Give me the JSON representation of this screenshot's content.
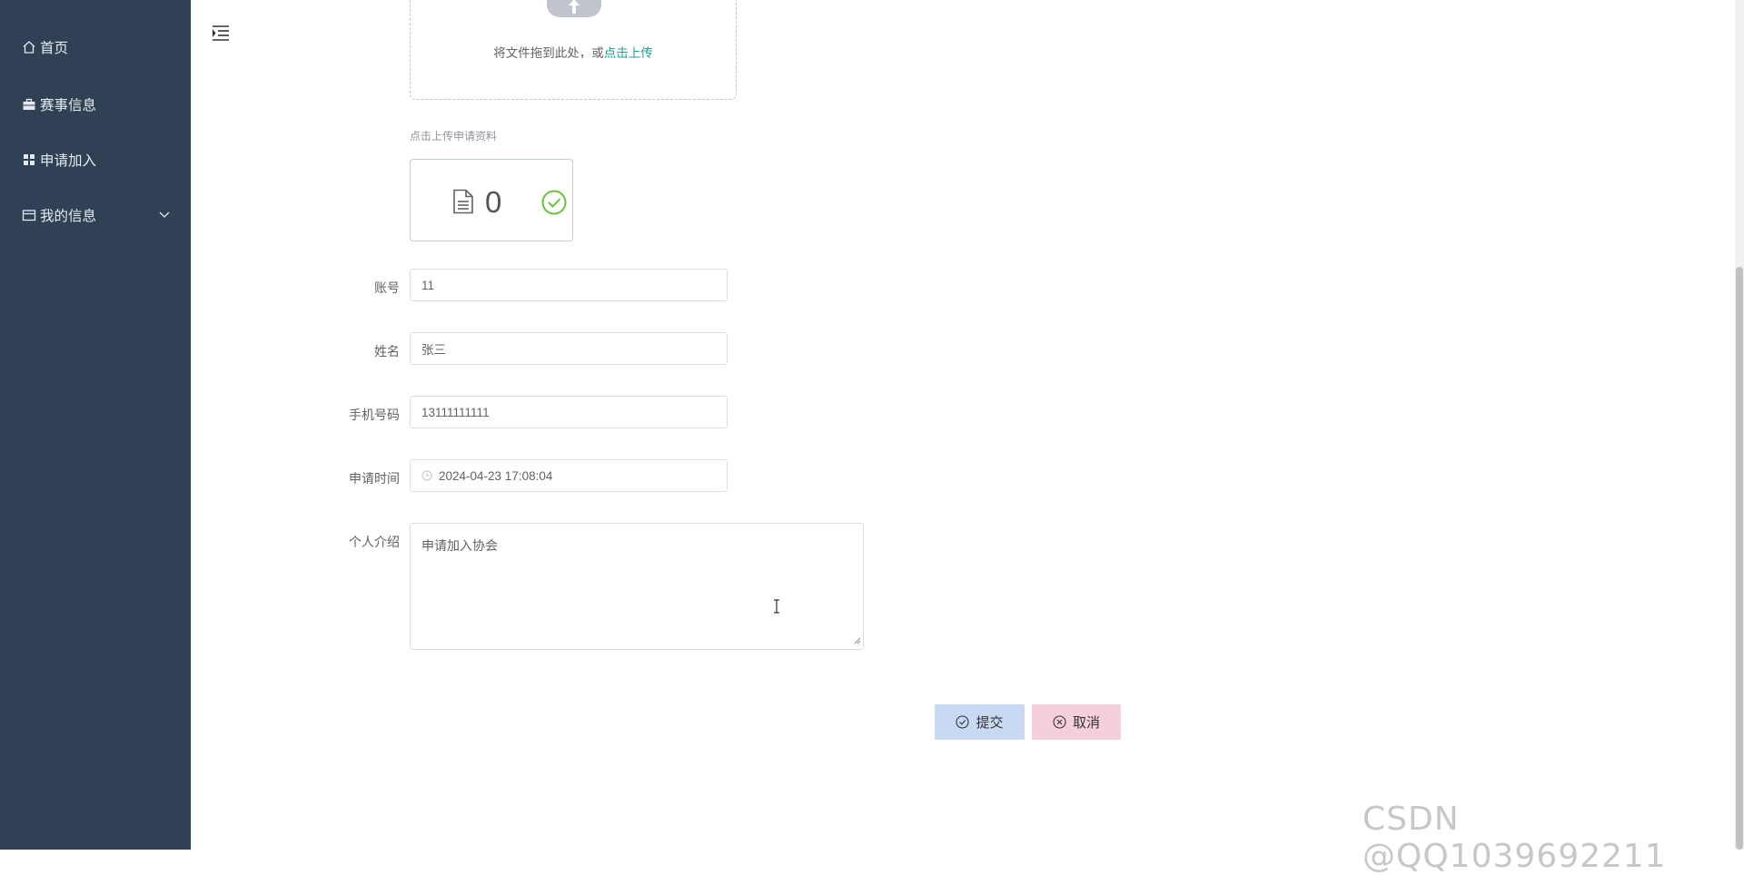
{
  "sidebar": {
    "items": [
      {
        "label": "首页",
        "icon": "home-icon"
      },
      {
        "label": "赛事信息",
        "icon": "briefcase-icon"
      },
      {
        "label": "申请加入",
        "icon": "grid-icon"
      },
      {
        "label": "我的信息",
        "icon": "card-icon"
      }
    ],
    "background": "#304156"
  },
  "upload": {
    "drag_text": "将文件拖到此处，或",
    "click_text": "点击上传",
    "tip": "点击上传申请资料",
    "file_count": "0"
  },
  "form": {
    "account_label": "账号",
    "account_value": "11",
    "name_label": "姓名",
    "name_value": "张三",
    "phone_label": "手机号码",
    "phone_value": "13111111111",
    "time_label": "申请时间",
    "time_value": "2024-04-23 17:08:04",
    "intro_label": "个人介绍",
    "intro_value": "申请加入协会"
  },
  "buttons": {
    "submit_label": "提交",
    "cancel_label": "取消"
  },
  "watermark": "CSDN @QQ1039692211",
  "colors": {
    "accent": "#1aa394",
    "submit_bg": "#c8daf3",
    "cancel_bg": "#f5d0da",
    "success": "#67c23a"
  }
}
